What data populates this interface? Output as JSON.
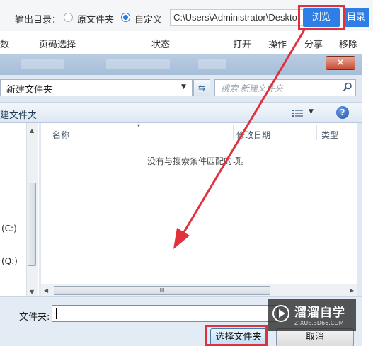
{
  "output_bar": {
    "label": "输出目录：",
    "radio_source": "原文件夹",
    "radio_custom": "自定义",
    "path_value": "C:\\Users\\Administrator\\Deskto",
    "browse_button": "浏览",
    "dir_button": "目录"
  },
  "table_header": {
    "col_count": "数",
    "col_page": "页码选择",
    "col_status": "状态",
    "col_open": "打开",
    "col_action": "操作",
    "col_share": "分享",
    "col_remove": "移除"
  },
  "dialog": {
    "close_glyph": "✕",
    "address": "新建文件夹",
    "search_placeholder": "搜索 新建文件夹",
    "cmd_new_folder": "建文件夹",
    "help_glyph": "?",
    "nav_items": [
      "(C:)",
      "(Q:)"
    ],
    "columns": {
      "name": "名称",
      "date": "修改日期",
      "type": "类型"
    },
    "empty_message": "没有与搜索条件匹配的项。",
    "hscroll_grip": "III",
    "folder_label": "文件夹:",
    "folder_value": "",
    "select_button": "选择文件夹",
    "cancel_button": "取消"
  },
  "watermark": {
    "title": "溜溜自学",
    "url": "ZIXUE.3D66.COM"
  },
  "colors": {
    "accent_blue": "#2e7ee6",
    "highlight_red": "#e0323c"
  },
  "icons": [
    "radio-icon",
    "refresh-icon",
    "search-icon",
    "view-icon",
    "help-icon",
    "close-icon",
    "play-logo-icon",
    "arrow-annotation"
  ]
}
